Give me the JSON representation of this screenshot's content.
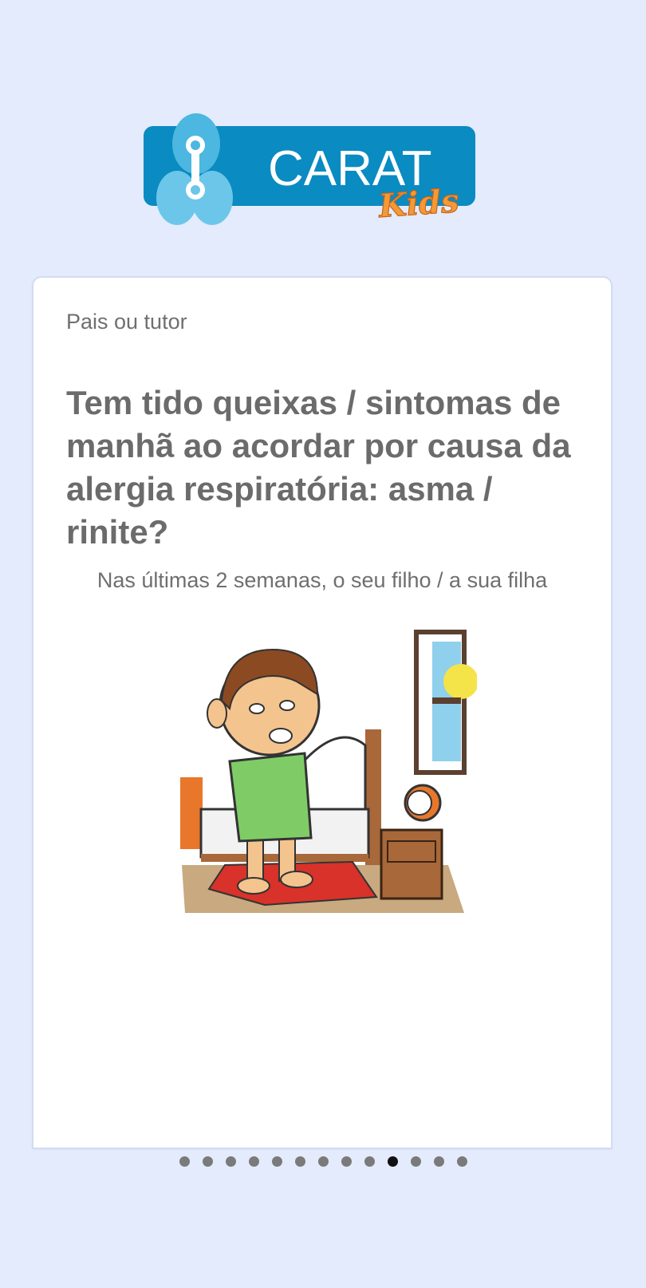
{
  "logo": {
    "title": "CARAT",
    "subtitle": "Kids",
    "brand_color": "#0a8bc1",
    "accent_color": "#f39a36"
  },
  "card": {
    "respondent": "Pais ou tutor",
    "question": "Tem tido queixas / sintomas de manhã ao acordar por causa da alergia respiratória: asma / rinite?",
    "subtitle": "Nas últimas 2 semanas, o seu filho / a sua filha",
    "illustration_icon": "sick-child-waking-up-illustration"
  },
  "pagination": {
    "total": 13,
    "active_index": 9
  }
}
